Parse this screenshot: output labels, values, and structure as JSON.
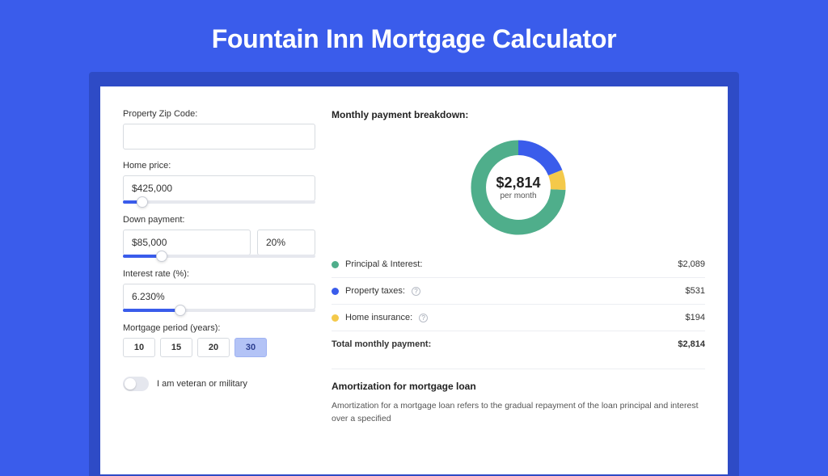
{
  "title": "Fountain Inn Mortgage Calculator",
  "colors": {
    "green": "#4fae8b",
    "blue": "#3a5ceb",
    "yellow": "#f4c94a"
  },
  "form": {
    "zip_label": "Property Zip Code:",
    "zip_value": "",
    "home_price_label": "Home price:",
    "home_price_value": "$425,000",
    "home_price_slider_pct": 10,
    "down_payment_label": "Down payment:",
    "down_payment_value": "$85,000",
    "down_payment_pct_value": "20%",
    "down_payment_slider_pct": 20,
    "interest_label": "Interest rate (%):",
    "interest_value": "6.230%",
    "interest_slider_pct": 30,
    "period_label": "Mortgage period (years):",
    "period_options": [
      "10",
      "15",
      "20",
      "30"
    ],
    "period_selected": "30",
    "veteran_label": "I am veteran or military",
    "veteran_on": false
  },
  "breakdown": {
    "title": "Monthly payment breakdown:",
    "center_amount": "$2,814",
    "center_sub": "per month",
    "items": [
      {
        "label": "Principal & Interest:",
        "value": "$2,089",
        "color": "green",
        "info": false,
        "pct": 74.2
      },
      {
        "label": "Property taxes:",
        "value": "$531",
        "color": "blue",
        "info": true,
        "pct": 18.9
      },
      {
        "label": "Home insurance:",
        "value": "$194",
        "color": "yellow",
        "info": true,
        "pct": 6.9
      }
    ],
    "total_label": "Total monthly payment:",
    "total_value": "$2,814"
  },
  "amortization": {
    "title": "Amortization for mortgage loan",
    "text": "Amortization for a mortgage loan refers to the gradual repayment of the loan principal and interest over a specified"
  },
  "chart_data": {
    "type": "pie",
    "title": "Monthly payment breakdown",
    "series": [
      {
        "name": "Principal & Interest",
        "value": 2089
      },
      {
        "name": "Property taxes",
        "value": 531
      },
      {
        "name": "Home insurance",
        "value": 194
      }
    ],
    "total": 2814,
    "unit": "USD per month"
  }
}
